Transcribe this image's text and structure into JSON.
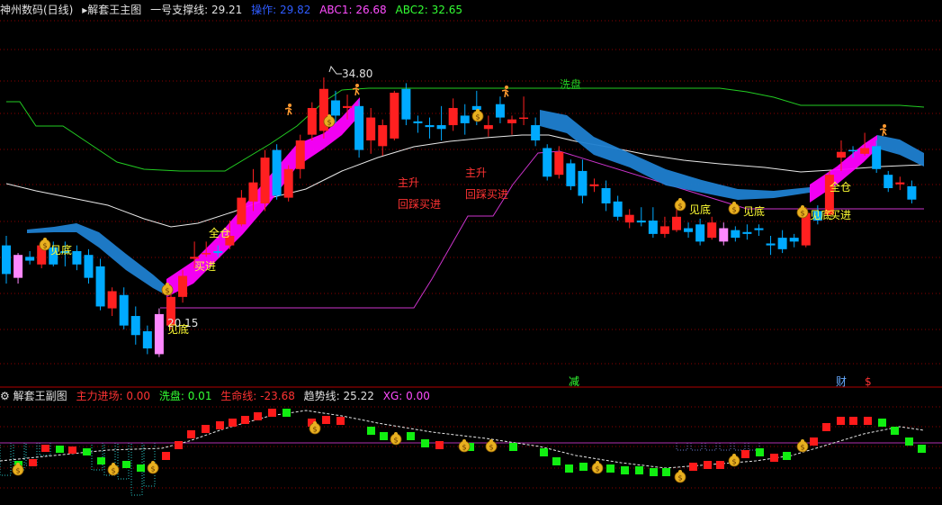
{
  "main_legend": {
    "stock_name": "神州数码(日线)",
    "chart_name": "解套王主图",
    "support_label": "一号支撑线:",
    "support_value": "29.21",
    "operation_label": "操作:",
    "operation_value": "29.82",
    "abc1_label": "ABC1:",
    "abc1_value": "26.68",
    "abc2_label": "ABC2:",
    "abc2_value": "32.65"
  },
  "sub_legend": {
    "chart_name": "解套王副图",
    "main_entry_label": "主力进场:",
    "main_entry_value": "0.00",
    "wash_label": "洗盘:",
    "wash_value": "0.01",
    "lifeline_label": "生命线:",
    "lifeline_value": "-23.68",
    "trend_label": "趋势线:",
    "trend_value": "25.22",
    "xg_label": "XG:",
    "xg_value": "0.00"
  },
  "annotations": {
    "high_price": "34.80",
    "low_price": "20.15",
    "wash_label": "洗盘",
    "bottom_label": "见底",
    "full_position": "全仓",
    "buy_in": "买进",
    "main_rise": "主升",
    "pullback_buy": "回踩买进",
    "marker_reduce": "减",
    "marker_wealth": "财",
    "marker_dollar": "$"
  },
  "colors": {
    "up": "#ff2020",
    "down": "#00aaff",
    "pink": "#ff88ff",
    "ribbon_bull": "#ff00ff",
    "ribbon_bear": "#1f7fd0",
    "white_ma": "#e8e8e8",
    "green_line": "#22cc22",
    "magenta_line": "#cc33cc",
    "grid": "#8b0000",
    "money_bag": "#e8b020"
  },
  "chart_data": {
    "type": "candlestick",
    "price_range": [
      19,
      36
    ],
    "candles": [
      {
        "o": 26.0,
        "h": 26.5,
        "l": 24.0,
        "c": 24.5,
        "k": "d"
      },
      {
        "o": 24.3,
        "h": 25.6,
        "l": 24.0,
        "c": 25.5,
        "k": "p"
      },
      {
        "o": 25.2,
        "h": 25.7,
        "l": 25.0,
        "c": 25.4,
        "k": "d"
      },
      {
        "o": 25.0,
        "h": 26.1,
        "l": 24.8,
        "c": 26.0,
        "k": "u"
      },
      {
        "o": 25.9,
        "h": 26.2,
        "l": 24.9,
        "c": 25.0,
        "k": "d"
      },
      {
        "o": 25.7,
        "h": 26.2,
        "l": 24.9,
        "c": 25.6,
        "k": "d"
      },
      {
        "o": 25.7,
        "h": 26.0,
        "l": 24.7,
        "c": 25.0,
        "k": "d"
      },
      {
        "o": 25.5,
        "h": 25.8,
        "l": 24.0,
        "c": 24.3,
        "k": "d"
      },
      {
        "o": 24.9,
        "h": 25.3,
        "l": 22.6,
        "c": 22.8,
        "k": "d"
      },
      {
        "o": 22.7,
        "h": 23.8,
        "l": 22.3,
        "c": 23.6,
        "k": "u"
      },
      {
        "o": 23.4,
        "h": 23.8,
        "l": 21.6,
        "c": 21.8,
        "k": "d"
      },
      {
        "o": 22.3,
        "h": 22.8,
        "l": 20.8,
        "c": 21.3,
        "k": "d"
      },
      {
        "o": 21.5,
        "h": 21.8,
        "l": 20.3,
        "c": 20.6,
        "k": "d"
      },
      {
        "o": 20.3,
        "h": 22.7,
        "l": 20.15,
        "c": 22.4,
        "k": "p"
      },
      {
        "o": 21.8,
        "h": 23.6,
        "l": 21.6,
        "c": 23.3,
        "k": "u"
      },
      {
        "o": 23.3,
        "h": 24.7,
        "l": 23.0,
        "c": 24.4,
        "k": "u"
      },
      {
        "o": 25.3,
        "h": 26.2,
        "l": 24.8,
        "c": 25.4,
        "k": "u"
      },
      {
        "o": 25.6,
        "h": 26.2,
        "l": 25.4,
        "c": 25.6,
        "k": "u"
      },
      {
        "o": 25.6,
        "h": 26.0,
        "l": 25.4,
        "c": 25.7,
        "k": "d"
      },
      {
        "o": 26.0,
        "h": 27.3,
        "l": 25.8,
        "c": 26.5,
        "k": "u"
      },
      {
        "o": 27.1,
        "h": 28.9,
        "l": 27.0,
        "c": 28.5,
        "k": "u"
      },
      {
        "o": 28.3,
        "h": 30.0,
        "l": 27.8,
        "c": 29.3,
        "k": "u"
      },
      {
        "o": 28.2,
        "h": 31.0,
        "l": 27.8,
        "c": 30.6,
        "k": "u"
      },
      {
        "o": 31.0,
        "h": 31.3,
        "l": 28.4,
        "c": 28.6,
        "k": "d"
      },
      {
        "o": 28.5,
        "h": 30.2,
        "l": 28.3,
        "c": 30.0,
        "k": "u"
      },
      {
        "o": 30.0,
        "h": 31.8,
        "l": 29.5,
        "c": 31.5,
        "k": "u"
      },
      {
        "o": 31.8,
        "h": 33.5,
        "l": 31.5,
        "c": 33.2,
        "k": "u"
      },
      {
        "o": 32.0,
        "h": 34.8,
        "l": 31.6,
        "c": 34.2,
        "k": "u"
      },
      {
        "o": 33.6,
        "h": 34.1,
        "l": 32.4,
        "c": 32.8,
        "k": "d"
      },
      {
        "o": 33.2,
        "h": 33.9,
        "l": 32.6,
        "c": 33.3,
        "k": "u"
      },
      {
        "o": 33.3,
        "h": 33.6,
        "l": 30.6,
        "c": 31.0,
        "k": "d"
      },
      {
        "o": 31.5,
        "h": 33.2,
        "l": 30.8,
        "c": 32.7,
        "k": "u"
      },
      {
        "o": 31.2,
        "h": 32.6,
        "l": 30.7,
        "c": 32.3,
        "k": "u"
      },
      {
        "o": 31.6,
        "h": 34.1,
        "l": 31.5,
        "c": 34.0,
        "k": "u"
      },
      {
        "o": 34.2,
        "h": 34.5,
        "l": 32.3,
        "c": 32.6,
        "k": "d"
      },
      {
        "o": 32.4,
        "h": 32.8,
        "l": 31.9,
        "c": 32.5,
        "k": "d"
      },
      {
        "o": 32.2,
        "h": 32.7,
        "l": 31.6,
        "c": 32.3,
        "k": "d"
      },
      {
        "o": 32.1,
        "h": 33.3,
        "l": 31.5,
        "c": 32.3,
        "k": "d"
      },
      {
        "o": 32.3,
        "h": 33.7,
        "l": 32.0,
        "c": 33.2,
        "k": "u"
      },
      {
        "o": 32.8,
        "h": 33.4,
        "l": 31.8,
        "c": 32.4,
        "k": "d"
      },
      {
        "o": 33.3,
        "h": 34.1,
        "l": 32.3,
        "c": 33.1,
        "k": "d"
      },
      {
        "o": 32.3,
        "h": 32.8,
        "l": 31.7,
        "c": 32.1,
        "k": "u"
      },
      {
        "o": 32.7,
        "h": 33.8,
        "l": 32.4,
        "c": 33.4,
        "k": "d"
      },
      {
        "o": 32.6,
        "h": 32.8,
        "l": 31.8,
        "c": 32.4,
        "k": "u"
      },
      {
        "o": 32.7,
        "h": 33.8,
        "l": 32.3,
        "c": 32.7,
        "k": "u"
      },
      {
        "o": 32.3,
        "h": 32.7,
        "l": 31.2,
        "c": 31.5,
        "k": "d"
      },
      {
        "o": 31.1,
        "h": 31.3,
        "l": 29.4,
        "c": 29.6,
        "k": "d"
      },
      {
        "o": 30.9,
        "h": 31.2,
        "l": 29.5,
        "c": 29.7,
        "k": "u"
      },
      {
        "o": 30.3,
        "h": 30.5,
        "l": 28.9,
        "c": 29.1,
        "k": "d"
      },
      {
        "o": 29.9,
        "h": 30.5,
        "l": 28.2,
        "c": 28.6,
        "k": "d"
      },
      {
        "o": 29.1,
        "h": 29.5,
        "l": 28.8,
        "c": 29.2,
        "k": "u"
      },
      {
        "o": 29.0,
        "h": 29.4,
        "l": 27.8,
        "c": 28.2,
        "k": "d"
      },
      {
        "o": 28.3,
        "h": 28.6,
        "l": 27.3,
        "c": 27.5,
        "k": "d"
      },
      {
        "o": 27.6,
        "h": 27.9,
        "l": 26.9,
        "c": 27.2,
        "k": "u"
      },
      {
        "o": 27.2,
        "h": 28.0,
        "l": 27.0,
        "c": 27.3,
        "k": "d"
      },
      {
        "o": 27.3,
        "h": 28.0,
        "l": 26.4,
        "c": 26.6,
        "k": "d"
      },
      {
        "o": 26.6,
        "h": 27.5,
        "l": 26.4,
        "c": 27.0,
        "k": "u"
      },
      {
        "o": 26.8,
        "h": 27.9,
        "l": 26.7,
        "c": 27.5,
        "k": "u"
      },
      {
        "o": 26.7,
        "h": 27.2,
        "l": 26.4,
        "c": 26.9,
        "k": "d"
      },
      {
        "o": 27.1,
        "h": 27.4,
        "l": 26.0,
        "c": 26.2,
        "k": "d"
      },
      {
        "o": 26.4,
        "h": 27.5,
        "l": 26.3,
        "c": 27.2,
        "k": "u"
      },
      {
        "o": 26.2,
        "h": 27.2,
        "l": 26.0,
        "c": 26.9,
        "k": "p"
      },
      {
        "o": 26.8,
        "h": 27.0,
        "l": 26.2,
        "c": 26.4,
        "k": "d"
      },
      {
        "o": 26.7,
        "h": 27.1,
        "l": 26.3,
        "c": 26.6,
        "k": "d"
      },
      {
        "o": 26.8,
        "h": 27.1,
        "l": 26.5,
        "c": 26.9,
        "k": "d"
      },
      {
        "o": 26.1,
        "h": 26.5,
        "l": 25.5,
        "c": 26.0,
        "k": "d"
      },
      {
        "o": 26.4,
        "h": 26.8,
        "l": 25.6,
        "c": 25.8,
        "k": "d"
      },
      {
        "o": 26.2,
        "h": 26.6,
        "l": 25.9,
        "c": 26.4,
        "k": "d"
      },
      {
        "o": 26.0,
        "h": 28.0,
        "l": 25.9,
        "c": 27.7,
        "k": "u"
      },
      {
        "o": 27.3,
        "h": 28.1,
        "l": 27.1,
        "c": 27.8,
        "k": "d"
      },
      {
        "o": 27.6,
        "h": 29.9,
        "l": 27.6,
        "c": 29.7,
        "k": "u"
      },
      {
        "o": 30.6,
        "h": 31.5,
        "l": 29.9,
        "c": 30.9,
        "k": "u"
      },
      {
        "o": 31.0,
        "h": 31.2,
        "l": 30.6,
        "c": 31.0,
        "k": "d"
      },
      {
        "o": 30.8,
        "h": 31.9,
        "l": 30.7,
        "c": 31.1,
        "k": "u"
      },
      {
        "o": 31.2,
        "h": 31.5,
        "l": 29.8,
        "c": 30.0,
        "k": "d"
      },
      {
        "o": 29.7,
        "h": 29.9,
        "l": 28.8,
        "c": 29.0,
        "k": "d"
      },
      {
        "o": 29.3,
        "h": 29.6,
        "l": 28.9,
        "c": 29.2,
        "k": "u"
      },
      {
        "o": 29.1,
        "h": 29.4,
        "l": 28.2,
        "c": 28.4,
        "k": "d"
      }
    ]
  }
}
